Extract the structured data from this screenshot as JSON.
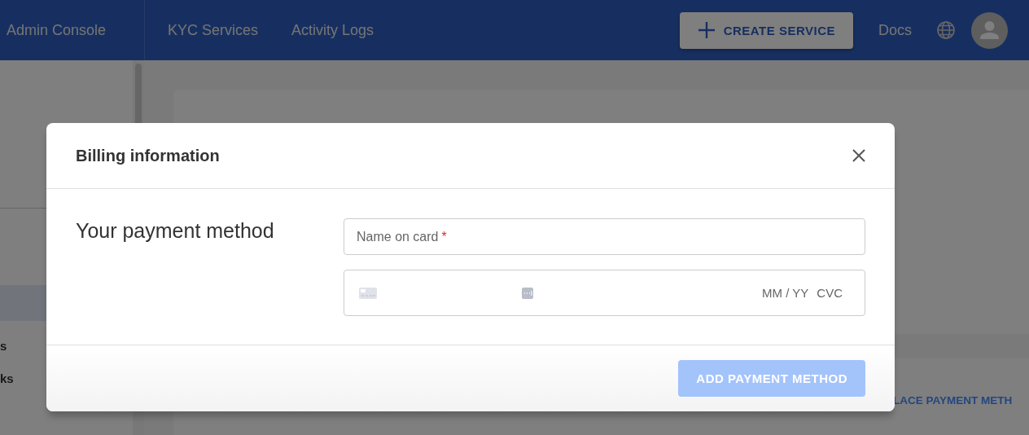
{
  "header": {
    "brand": "Admin Console",
    "nav": [
      {
        "label": "KYC Services"
      },
      {
        "label": "Activity Logs"
      }
    ],
    "create_button": {
      "label": "CREATE SERVICE"
    },
    "docs_link": "Docs"
  },
  "sidebar": {
    "items": [
      {
        "label": "s"
      },
      {
        "label": "ks"
      }
    ]
  },
  "background_card": {
    "button": "LACE PAYMENT METH"
  },
  "dialog": {
    "title": "Billing information",
    "section_label": "Your payment method",
    "name_field": {
      "placeholder": "Name on card",
      "required_mark": "*"
    },
    "card_field": {
      "expiry_placeholder": "MM / YY",
      "cvc_placeholder": "CVC"
    },
    "submit_button": {
      "label": "ADD PAYMENT METHOD",
      "disabled": true
    }
  }
}
